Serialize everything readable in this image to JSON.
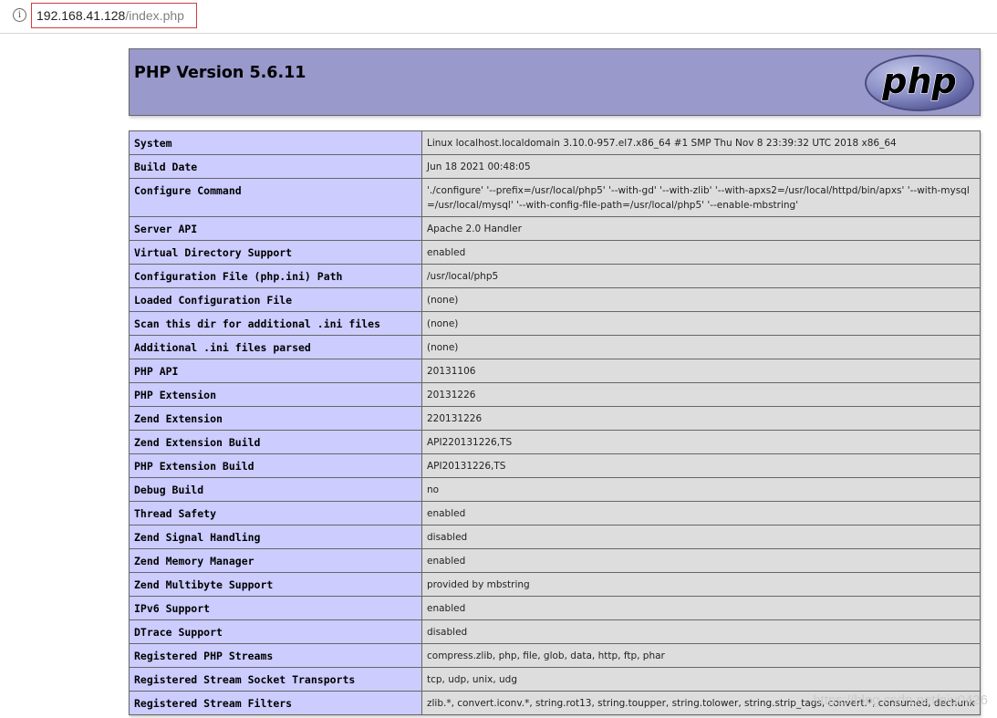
{
  "browser": {
    "url_host": "192.168.41.128",
    "url_path": "/index.php",
    "info_icon": "info-icon"
  },
  "header": {
    "title": "PHP Version 5.6.11",
    "logo_text": "php"
  },
  "rows": [
    {
      "key": "System",
      "value": "Linux localhost.localdomain 3.10.0-957.el7.x86_64 #1 SMP Thu Nov 8 23:39:32 UTC 2018 x86_64"
    },
    {
      "key": "Build Date",
      "value": "Jun 18 2021 00:48:05"
    },
    {
      "key": "Configure Command",
      "value": "'./configure' '--prefix=/usr/local/php5' '--with-gd' '--with-zlib' '--with-apxs2=/usr/local/httpd/bin/apxs' '--with-mysql=/usr/local/mysql' '--with-config-file-path=/usr/local/php5' '--enable-mbstring'"
    },
    {
      "key": "Server API",
      "value": "Apache 2.0 Handler"
    },
    {
      "key": "Virtual Directory Support",
      "value": "enabled"
    },
    {
      "key": "Configuration File (php.ini) Path",
      "value": "/usr/local/php5"
    },
    {
      "key": "Loaded Configuration File",
      "value": "(none)"
    },
    {
      "key": "Scan this dir for additional .ini files",
      "value": "(none)"
    },
    {
      "key": "Additional .ini files parsed",
      "value": "(none)"
    },
    {
      "key": "PHP API",
      "value": "20131106"
    },
    {
      "key": "PHP Extension",
      "value": "20131226"
    },
    {
      "key": "Zend Extension",
      "value": "220131226"
    },
    {
      "key": "Zend Extension Build",
      "value": "API220131226,TS"
    },
    {
      "key": "PHP Extension Build",
      "value": "API20131226,TS"
    },
    {
      "key": "Debug Build",
      "value": "no"
    },
    {
      "key": "Thread Safety",
      "value": "enabled"
    },
    {
      "key": "Zend Signal Handling",
      "value": "disabled"
    },
    {
      "key": "Zend Memory Manager",
      "value": "enabled"
    },
    {
      "key": "Zend Multibyte Support",
      "value": "provided by mbstring"
    },
    {
      "key": "IPv6 Support",
      "value": "enabled"
    },
    {
      "key": "DTrace Support",
      "value": "disabled"
    },
    {
      "key": "Registered PHP Streams",
      "value": "compress.zlib, php, file, glob, data, http, ftp, phar"
    },
    {
      "key": "Registered Stream Socket Transports",
      "value": "tcp, udp, unix, udg"
    },
    {
      "key": "Registered Stream Filters",
      "value": "zlib.*, convert.iconv.*, string.rot13, string.toupper, string.tolower, string.strip_tags, convert.*, consumed, dechunk"
    }
  ],
  "watermark": "https://blog.csdn.net/niu0426",
  "colors": {
    "header_bg": "#9999cc",
    "key_bg": "#ccccff",
    "value_bg": "#dddddd",
    "border": "#666666",
    "url_highlight": "#d43a3a"
  }
}
